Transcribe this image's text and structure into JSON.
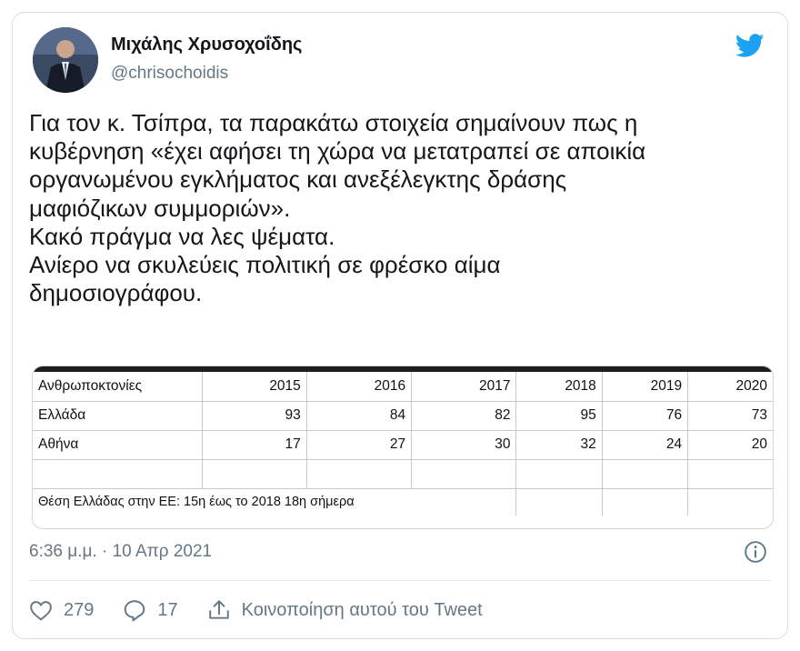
{
  "author": {
    "name": "Μιχάλης Χρυσοχοΐδης",
    "handle": "@chrisochoidis"
  },
  "icons": {
    "brand": "twitter-bird-icon",
    "info": "info-icon",
    "like": "heart-icon",
    "reply": "reply-icon",
    "share": "share-icon"
  },
  "colors": {
    "brand": "#1da1f2",
    "secondary_text": "#657786"
  },
  "tweet": {
    "lines": [
      "Για τον κ. Τσίπρα, τα παρακάτω στοιχεία σημαίνουν πως η",
      "κυβέρνηση «έχει αφήσει τη χώρα να μετατραπεί σε αποικία",
      "οργανωμένου εγκλήματος και ανεξέλεγκτης δράσης",
      "μαφιόζικων συμμοριών».",
      "Κακό πράγμα να λες ψέματα.",
      "Ανίερο να σκυλεύεις πολιτική σε φρέσκο αίμα",
      "δημοσιογράφου."
    ]
  },
  "table": {
    "header": [
      "Ανθρωποκτονίες",
      "2015",
      "2016",
      "2017",
      "2018",
      "2019",
      "2020"
    ],
    "rows": [
      [
        "Ελλάδα",
        "93",
        "84",
        "82",
        "95",
        "76",
        "73"
      ],
      [
        "Αθήνα",
        "17",
        "27",
        "30",
        "32",
        "24",
        "20"
      ]
    ],
    "note": "Θέση Ελλάδας στην ΕΕ: 15η έως το 2018 18η σήμερα"
  },
  "meta": {
    "timestamp": "6:36 μ.μ. · 10 Απρ 2021"
  },
  "actions": {
    "likes": "279",
    "replies": "17",
    "share_label": "Κοινοποίηση αυτού του Tweet"
  }
}
